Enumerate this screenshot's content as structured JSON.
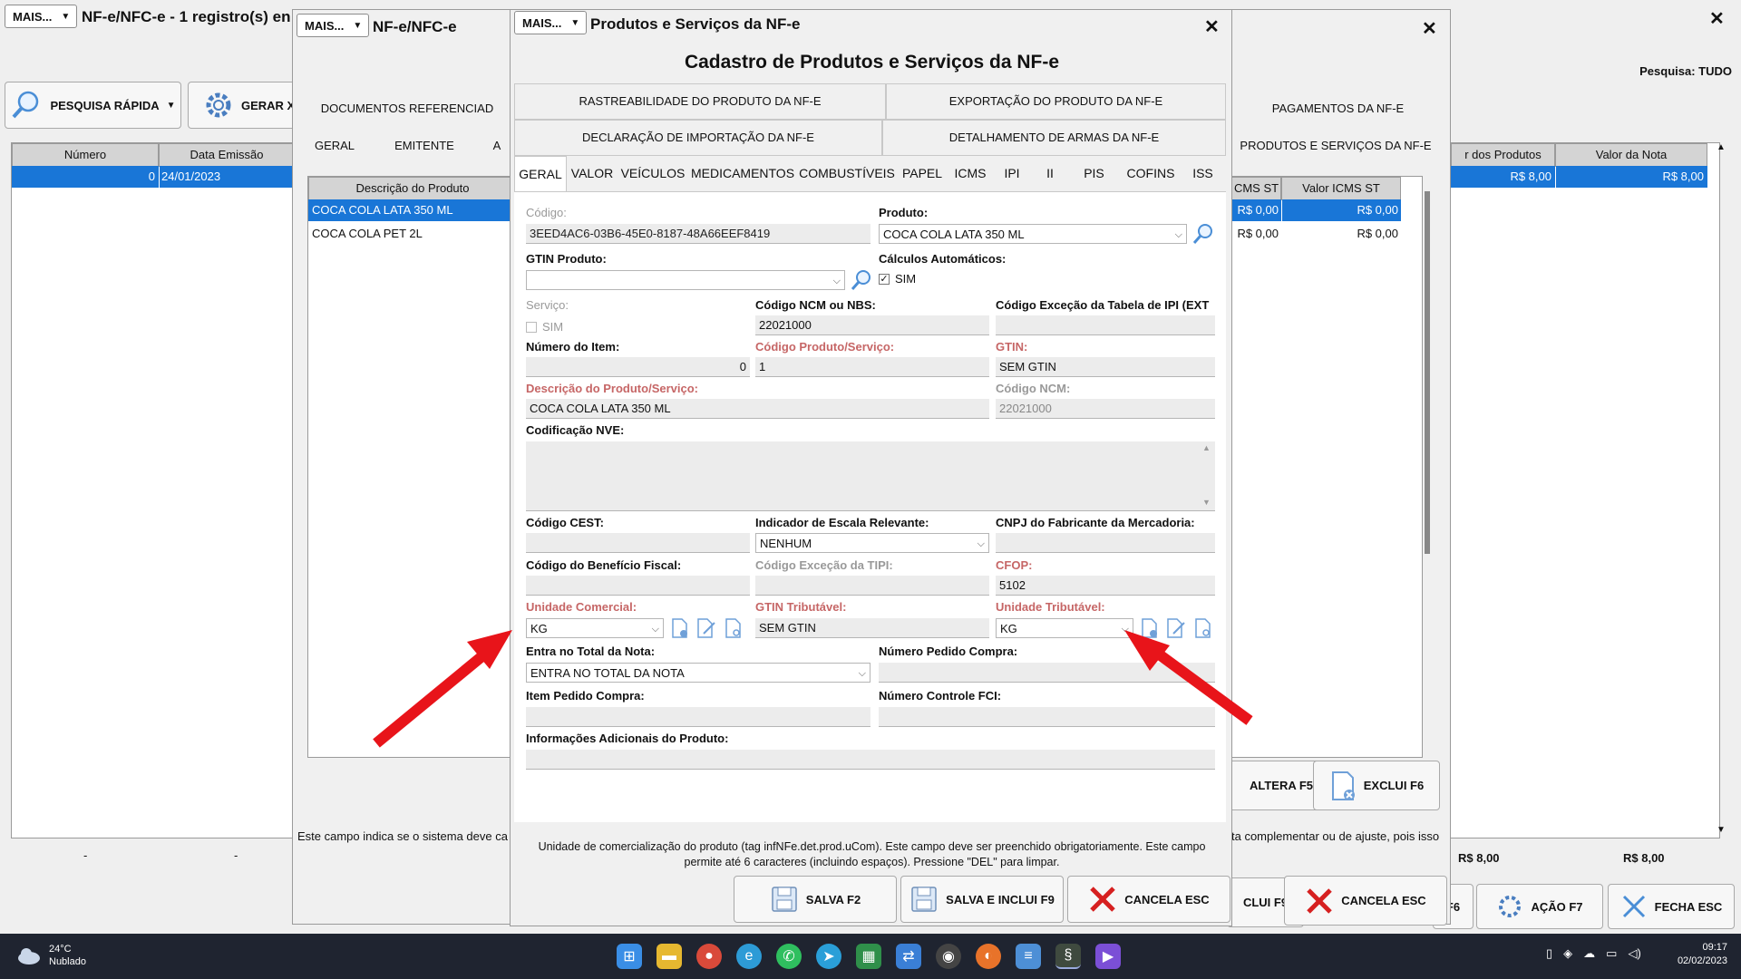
{
  "colors": {
    "selection": "#1976d7",
    "required": "#c66666",
    "arrow": "#e8141a",
    "cancel_x": "#d62020"
  },
  "bg_window": {
    "mais": "MAIS...",
    "title": "NF-e/NFC-e - 1 registro(s) enco",
    "quick_search": "PESQUISA RÁPIDA",
    "gerar": "GERAR X",
    "search_label": "Pesquisa: TUDO",
    "headers": [
      "Número",
      "Data Emissão"
    ],
    "right_headers": [
      "r dos Produtos",
      "Valor da Nota"
    ],
    "row": {
      "numero": "0",
      "data": "24/01/2023",
      "valor_produtos": "R$ 8,00",
      "valor_nota": "R$ 8,00"
    },
    "totals": {
      "dash1": "-",
      "dash2": "-",
      "total1": "R$ 8,00",
      "total2": "R$ 8,00"
    },
    "buttons": {
      "f6": "F6",
      "acao": "AÇÃO F7",
      "fecha": "FECHA ESC"
    }
  },
  "mid_window": {
    "mais": "MAIS...",
    "title": "NF-e/NFC-e",
    "tabs_top": [
      "DOCUMENTOS REFERENCIAD",
      "PAGAMENTOS DA NF-E"
    ],
    "tabs_bottom": [
      "GERAL",
      "EMITENTE",
      "A",
      "PRODUTOS E SERVIÇOS DA NF-E"
    ],
    "grid_header": "Descrição do Produto",
    "items": [
      "COCA COLA LATA 350 ML",
      "COCA COLA PET 2L"
    ],
    "right_headers": [
      "CMS ST",
      "Valor ICMS ST"
    ],
    "right_rows": [
      [
        "R$ 0,00",
        "R$ 0,00"
      ],
      [
        "R$ 0,00",
        "R$ 0,00"
      ]
    ],
    "hint": "Este campo indica se o sistema deve ca",
    "hint_right": "ta complementar ou de ajuste, pois isso",
    "buttons": {
      "altera": "ALTERA F5",
      "exclui": "EXCLUI F6",
      "inclui": "CLUI F9",
      "cancela": "CANCELA ESC"
    }
  },
  "dialog": {
    "mais": "MAIS...",
    "window_title": "Produtos e Serviços da NF-e",
    "heading": "Cadastro de Produtos e Serviços da NF-e",
    "top_tabs": [
      [
        "RASTREABILIDADE DO PRODUTO DA NF-E",
        "EXPORTAÇÃO DO PRODUTO DA NF-E"
      ],
      [
        "DECLARAÇÃO DE IMPORTAÇÃO DA NF-E",
        "DETALHAMENTO DE ARMAS DA NF-E"
      ]
    ],
    "sub_tabs": [
      "GERAL",
      "VALOR",
      "VEÍCULOS",
      "MEDICAMENTOS",
      "COMBUSTÍVEIS",
      "PAPEL",
      "ICMS",
      "IPI",
      "II",
      "PIS",
      "COFINS",
      "ISS"
    ],
    "fields": {
      "codigo": {
        "label": "Código:",
        "value": "3EED4AC6-03B6-45E0-8187-48A66EEF8419"
      },
      "produto": {
        "label": "Produto:",
        "value": "COCA COLA LATA 350 ML"
      },
      "gtin_produto": {
        "label": "GTIN Produto:",
        "value": ""
      },
      "calc_auto": {
        "label": "Cálculos Automáticos:",
        "option": "SIM",
        "checked": true
      },
      "servico": {
        "label": "Serviço:",
        "option": "SIM",
        "checked": false
      },
      "ncm_nbs": {
        "label": "Código NCM ou NBS:",
        "value": "22021000"
      },
      "excecao_ipi": {
        "label": "Código Exceção da Tabela de IPI (EXT",
        "value": ""
      },
      "numero_item": {
        "label": "Número do Item:",
        "value": "0"
      },
      "codigo_prod": {
        "label": "Código Produto/Serviço:",
        "value": "1"
      },
      "gtin": {
        "label": "GTIN:",
        "value": "SEM GTIN"
      },
      "descricao": {
        "label": "Descrição do Produto/Serviço:",
        "value": "COCA COLA LATA 350 ML"
      },
      "codigo_ncm": {
        "label": "Código NCM:",
        "value": "22021000"
      },
      "nve": {
        "label": "Codificação NVE:",
        "value": ""
      },
      "cest": {
        "label": "Código CEST:",
        "value": ""
      },
      "escala": {
        "label": "Indicador de Escala Relevante:",
        "value": "NENHUM"
      },
      "cnpj_fab": {
        "label": "CNPJ do Fabricante da Mercadoria:",
        "value": ""
      },
      "beneficio": {
        "label": "Código do Benefício Fiscal:",
        "value": ""
      },
      "excecao_tipi": {
        "label": "Código Exceção da TIPI:",
        "value": ""
      },
      "cfop": {
        "label": "CFOP:",
        "value": "5102"
      },
      "unid_com": {
        "label": "Unidade Comercial:",
        "value": "KG"
      },
      "gtin_trib": {
        "label": "GTIN Tributável:",
        "value": "SEM GTIN"
      },
      "unid_trib": {
        "label": "Unidade Tributável:",
        "value": "KG"
      },
      "entra_total": {
        "label": "Entra no Total da Nota:",
        "value": "ENTRA NO TOTAL DA NOTA"
      },
      "pedido_compra": {
        "label": "Número Pedido Compra:",
        "value": ""
      },
      "item_pedido": {
        "label": "Item Pedido Compra:",
        "value": ""
      },
      "fci": {
        "label": "Número Controle FCI:",
        "value": ""
      },
      "info_adic": {
        "label": "Informações Adicionais do Produto:",
        "value": ""
      }
    },
    "help": "Unidade de comercialização do produto (tag infNFe.det.prod.uCom). Este campo deve ser preenchido obrigatoriamente. Este campo permite até 6 caracteres (incluindo espaços). Pressione \"DEL\" para limpar.",
    "buttons": {
      "salva": "SALVA F2",
      "salva_inclui": "SALVA E INCLUI F9",
      "cancela": "CANCELA ESC"
    }
  },
  "taskbar": {
    "temp": "24°C",
    "weather": "Nublado",
    "time": "09:17",
    "date": "02/02/2023"
  }
}
